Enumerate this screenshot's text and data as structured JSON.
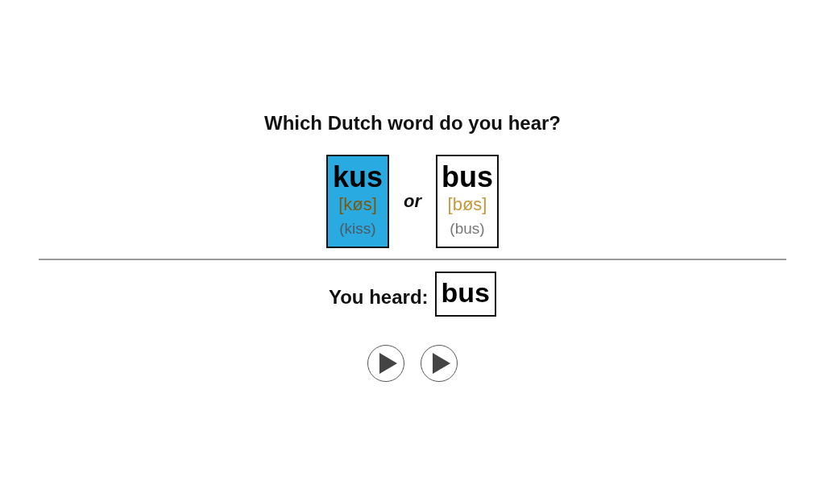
{
  "question": "Which Dutch word do you hear?",
  "choices": [
    {
      "word": "kus",
      "phonetic": "[køs]",
      "translation": "(kiss)",
      "selected": true
    },
    {
      "word": "bus",
      "phonetic": "[bøs]",
      "translation": "(bus)",
      "selected": false
    }
  ],
  "separator": "or",
  "answer": {
    "label": "You heard:",
    "word": "bus"
  },
  "play_buttons": [
    {
      "kind": "play"
    },
    {
      "kind": "play"
    }
  ]
}
